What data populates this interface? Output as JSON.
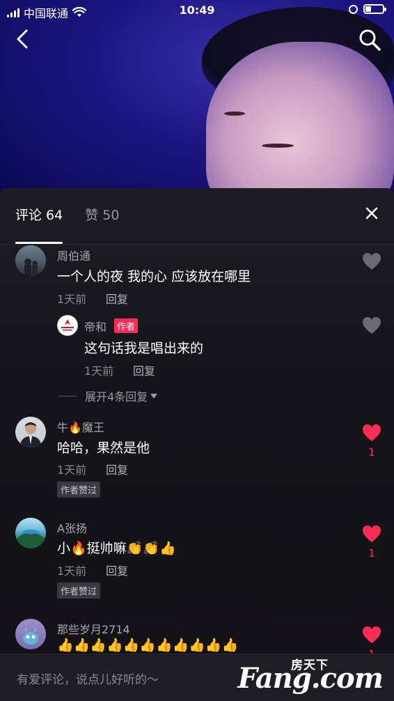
{
  "status_bar": {
    "carrier": "中国联通",
    "time": "10:49"
  },
  "tabs": {
    "comments": "评论 64",
    "likes": "赞 50"
  },
  "comments": [
    {
      "name": "周伯通",
      "text": "一个人的夜 我的心 应该放在哪里",
      "time": "1天前",
      "reply": "回复",
      "liked": false
    },
    {
      "name": "帝和",
      "badge": "作者",
      "text": "这句话我是唱出来的",
      "time": "1天前",
      "reply": "回复",
      "liked": false,
      "is_reply": true
    },
    {
      "name": "牛🔥魔王",
      "text": "哈哈，果然是他",
      "time": "1天前",
      "reply": "回复",
      "liked": true,
      "like_count": "1",
      "author_liked": "作者赞过"
    },
    {
      "name": "A张扬",
      "text": "小🔥挺帅嘛👏👏👍",
      "time": "1天前",
      "reply": "回复",
      "liked": true,
      "like_count": "1",
      "author_liked": "作者赞过"
    },
    {
      "name": "那些岁月2714",
      "text": "👍👍👍👍👍👍👍👍👍👍👍",
      "liked": true,
      "like_count": "1"
    }
  ],
  "expand_replies": "展开4条回复",
  "input": {
    "placeholder": "有爱评论，说点儿好听的～"
  },
  "watermark": {
    "top": "房天下",
    "main": "Fang.com"
  },
  "colors": {
    "accent": "#fe2c55",
    "sheet_bg": "#15141a"
  }
}
